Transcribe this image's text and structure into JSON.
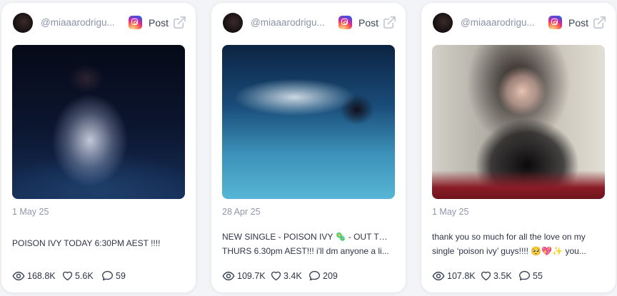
{
  "cards": [
    {
      "handle": "@miaaarodrigu...",
      "post_label": "Post",
      "date": "1 May 25",
      "caption": [
        "POISON IVY TODAY 6:30PM AEST !!!!"
      ],
      "views": "168.8K",
      "likes": "5.6K",
      "comments": "59"
    },
    {
      "handle": "@miaaarodrigu...",
      "post_label": "Post",
      "date": "28 Apr 25",
      "caption": [
        "NEW SINGLE - POISON IVY 🦠 - OUT THIS",
        "THURS 6.30pm AEST!!! i'll dm anyone a li..."
      ],
      "views": "109.7K",
      "likes": "3.4K",
      "comments": "209"
    },
    {
      "handle": "@miaaarodrigu...",
      "post_label": "Post",
      "date": "1 May 25",
      "caption": [
        "thank you so much for all the love on my",
        "single ‘poison ivy’ guys!!!! 🥺💖✨ you..."
      ],
      "views": "107.8K",
      "likes": "3.5K",
      "comments": "55"
    }
  ],
  "icons": {
    "platform": "instagram-icon",
    "open": "external-link-icon",
    "views": "eye-icon",
    "likes": "heart-icon",
    "comments": "comment-icon"
  }
}
